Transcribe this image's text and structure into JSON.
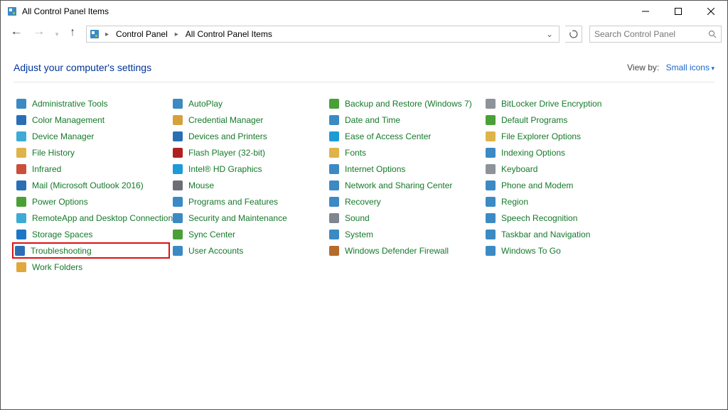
{
  "titlebar": {
    "title": "All Control Panel Items"
  },
  "breadcrumb": {
    "root": "Control Panel",
    "current": "All Control Panel Items"
  },
  "search": {
    "placeholder": "Search Control Panel"
  },
  "header": {
    "title": "Adjust your computer's settings",
    "viewby_label": "View by:",
    "viewby_value": "Small icons"
  },
  "cols": [
    [
      {
        "label": "Administrative Tools",
        "color": "#3b8ac4"
      },
      {
        "label": "Color Management",
        "color": "#2a6fb5"
      },
      {
        "label": "Device Manager",
        "color": "#3dabd6"
      },
      {
        "label": "File History",
        "color": "#deb34a"
      },
      {
        "label": "Infrared",
        "color": "#c94f3a"
      },
      {
        "label": "Mail (Microsoft Outlook 2016)",
        "color": "#2a6fb5"
      },
      {
        "label": "Power Options",
        "color": "#4aa037"
      },
      {
        "label": "RemoteApp and Desktop Connections",
        "color": "#3dabd6"
      },
      {
        "label": "Storage Spaces",
        "color": "#1d76c6"
      },
      {
        "label": "Troubleshooting",
        "color": "#2a6fb5",
        "highlight": true
      },
      {
        "label": "Work Folders",
        "color": "#e0a83a"
      }
    ],
    [
      {
        "label": "AutoPlay",
        "color": "#3b8ac4"
      },
      {
        "label": "Credential Manager",
        "color": "#d6a13a"
      },
      {
        "label": "Devices and Printers",
        "color": "#2a6fb5"
      },
      {
        "label": "Flash Player (32-bit)",
        "color": "#b02020"
      },
      {
        "label": "Intel® HD Graphics",
        "color": "#1d9bd6"
      },
      {
        "label": "Mouse",
        "color": "#6b6f75"
      },
      {
        "label": "Programs and Features",
        "color": "#3b8ac4"
      },
      {
        "label": "Security and Maintenance",
        "color": "#3b8ac4"
      },
      {
        "label": "Sync Center",
        "color": "#4aa037"
      },
      {
        "label": "User Accounts",
        "color": "#3b8ac4"
      }
    ],
    [
      {
        "label": "Backup and Restore (Windows 7)",
        "color": "#4aa037"
      },
      {
        "label": "Date and Time",
        "color": "#3b8ac4"
      },
      {
        "label": "Ease of Access Center",
        "color": "#1d9bd6"
      },
      {
        "label": "Fonts",
        "color": "#deb34a"
      },
      {
        "label": "Internet Options",
        "color": "#3b8ac4"
      },
      {
        "label": "Network and Sharing Center",
        "color": "#3b8ac4"
      },
      {
        "label": "Recovery",
        "color": "#3b8ac4"
      },
      {
        "label": "Sound",
        "color": "#808590"
      },
      {
        "label": "System",
        "color": "#3b8ac4"
      },
      {
        "label": "Windows Defender Firewall",
        "color": "#b66a2b"
      }
    ],
    [
      {
        "label": "BitLocker Drive Encryption",
        "color": "#8e9299"
      },
      {
        "label": "Default Programs",
        "color": "#4aa037"
      },
      {
        "label": "File Explorer Options",
        "color": "#deb34a"
      },
      {
        "label": "Indexing Options",
        "color": "#3b8ac4"
      },
      {
        "label": "Keyboard",
        "color": "#8e9299"
      },
      {
        "label": "Phone and Modem",
        "color": "#3b8ac4"
      },
      {
        "label": "Region",
        "color": "#3b8ac4"
      },
      {
        "label": "Speech Recognition",
        "color": "#3b8ac4"
      },
      {
        "label": "Taskbar and Navigation",
        "color": "#3b8ac4"
      },
      {
        "label": "Windows To Go",
        "color": "#3b8ac4"
      }
    ]
  ]
}
